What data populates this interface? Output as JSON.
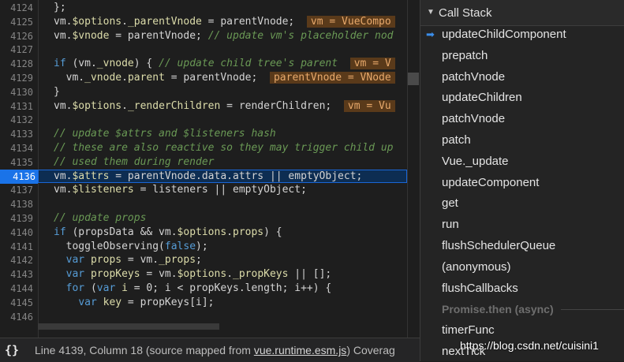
{
  "editor": {
    "lines": [
      {
        "n": "4124",
        "parts": [
          [
            "op",
            "};"
          ]
        ]
      },
      {
        "n": "4125",
        "parts": [
          [
            "op",
            "vm."
          ],
          [
            "prop",
            "$options"
          ],
          [
            "op",
            "."
          ],
          [
            "prop",
            "_parentVnode"
          ],
          [
            "op",
            " = parentVnode;  "
          ],
          [
            "inl",
            "vm = VueCompo"
          ]
        ]
      },
      {
        "n": "4126",
        "parts": [
          [
            "op",
            "vm."
          ],
          [
            "prop",
            "$vnode"
          ],
          [
            "op",
            " = parentVnode; "
          ],
          [
            "cm",
            "// update vm's placeholder nod"
          ]
        ]
      },
      {
        "n": "4127",
        "parts": []
      },
      {
        "n": "4128",
        "parts": [
          [
            "kw",
            "if"
          ],
          [
            "op",
            " (vm."
          ],
          [
            "prop",
            "_vnode"
          ],
          [
            "op",
            ") { "
          ],
          [
            "cm",
            "// update child tree's parent  "
          ],
          [
            "inl",
            "vm = V"
          ]
        ]
      },
      {
        "n": "4129",
        "parts": [
          [
            "op",
            "  vm."
          ],
          [
            "prop",
            "_vnode"
          ],
          [
            "op",
            "."
          ],
          [
            "prop",
            "parent"
          ],
          [
            "op",
            " = parentVnode;  "
          ],
          [
            "inl",
            "parentVnode = VNode"
          ]
        ]
      },
      {
        "n": "4130",
        "parts": [
          [
            "op",
            "}"
          ]
        ]
      },
      {
        "n": "4131",
        "parts": [
          [
            "op",
            "vm."
          ],
          [
            "prop",
            "$options"
          ],
          [
            "op",
            "."
          ],
          [
            "prop",
            "_renderChildren"
          ],
          [
            "op",
            " = renderChildren;  "
          ],
          [
            "inl",
            "vm = Vu"
          ]
        ]
      },
      {
        "n": "4132",
        "parts": []
      },
      {
        "n": "4133",
        "parts": [
          [
            "cm",
            "// update $attrs and $listeners hash"
          ]
        ]
      },
      {
        "n": "4134",
        "parts": [
          [
            "cm",
            "// these are also reactive so they may trigger child up"
          ]
        ]
      },
      {
        "n": "4135",
        "parts": [
          [
            "cm",
            "// used them during render"
          ]
        ]
      },
      {
        "n": "4136",
        "parts": [
          [
            "op",
            "vm."
          ],
          [
            "prop",
            "$attrs"
          ],
          [
            "op",
            " = parentVnode.data.attrs || emptyObject;"
          ]
        ],
        "active": true
      },
      {
        "n": "4137",
        "parts": [
          [
            "op",
            "vm."
          ],
          [
            "prop",
            "$listeners"
          ],
          [
            "op",
            " = listeners || emptyObject;"
          ]
        ]
      },
      {
        "n": "4138",
        "parts": []
      },
      {
        "n": "4139",
        "parts": [
          [
            "cm",
            "// update props"
          ]
        ]
      },
      {
        "n": "4140",
        "parts": [
          [
            "kw",
            "if"
          ],
          [
            "op",
            " (propsData && vm."
          ],
          [
            "prop",
            "$options"
          ],
          [
            "op",
            "."
          ],
          [
            "prop",
            "props"
          ],
          [
            "op",
            ") {"
          ]
        ]
      },
      {
        "n": "4141",
        "parts": [
          [
            "op",
            "  toggleObserving("
          ],
          [
            "kw",
            "false"
          ],
          [
            "op",
            ");"
          ]
        ]
      },
      {
        "n": "4142",
        "parts": [
          [
            "op",
            "  "
          ],
          [
            "kw",
            "var"
          ],
          [
            "op",
            " "
          ],
          [
            "prop",
            "props"
          ],
          [
            "op",
            " = vm."
          ],
          [
            "prop",
            "_props"
          ],
          [
            "op",
            ";"
          ]
        ]
      },
      {
        "n": "4143",
        "parts": [
          [
            "op",
            "  "
          ],
          [
            "kw",
            "var"
          ],
          [
            "op",
            " "
          ],
          [
            "prop",
            "propKeys"
          ],
          [
            "op",
            " = vm."
          ],
          [
            "prop",
            "$options"
          ],
          [
            "op",
            "."
          ],
          [
            "prop",
            "_propKeys"
          ],
          [
            "op",
            " || [];"
          ]
        ]
      },
      {
        "n": "4144",
        "parts": [
          [
            "op",
            "  "
          ],
          [
            "kw",
            "for"
          ],
          [
            "op",
            " ("
          ],
          [
            "kw",
            "var"
          ],
          [
            "op",
            " "
          ],
          [
            "prop",
            "i"
          ],
          [
            "op",
            " = 0; i < propKeys.length; i++) {"
          ]
        ]
      },
      {
        "n": "4145",
        "parts": [
          [
            "op",
            "    "
          ],
          [
            "kw",
            "var"
          ],
          [
            "op",
            " "
          ],
          [
            "prop",
            "key"
          ],
          [
            "op",
            " = propKeys[i];"
          ]
        ]
      },
      {
        "n": "4146",
        "parts": []
      }
    ]
  },
  "status": {
    "icon": "curly-braces-icon",
    "braces": "{}",
    "prefix": "Line 4139, Column 18  (source mapped from ",
    "link": "vue.runtime.esm.js",
    "suffix": ")  Coverag"
  },
  "panel": {
    "title": "Call Stack",
    "frames": [
      {
        "label": "updateChildComponent",
        "current": true
      },
      {
        "label": "prepatch"
      },
      {
        "label": "patchVnode"
      },
      {
        "label": "updateChildren"
      },
      {
        "label": "patchVnode"
      },
      {
        "label": "patch"
      },
      {
        "label": "Vue._update"
      },
      {
        "label": "updateComponent"
      },
      {
        "label": "get"
      },
      {
        "label": "run"
      },
      {
        "label": "flushSchedulerQueue"
      },
      {
        "label": "(anonymous)"
      },
      {
        "label": "flushCallbacks"
      },
      {
        "label": "Promise.then (async)",
        "async": true
      },
      {
        "label": "timerFunc"
      },
      {
        "label": "nextTick"
      }
    ]
  },
  "watermark": "https://blog.csdn.net/cuisini1",
  "colors": {
    "accent": "#1a73e8",
    "inline_value_bg": "#5a3a1a",
    "comment": "#6a9955",
    "keyword": "#569cd6"
  }
}
